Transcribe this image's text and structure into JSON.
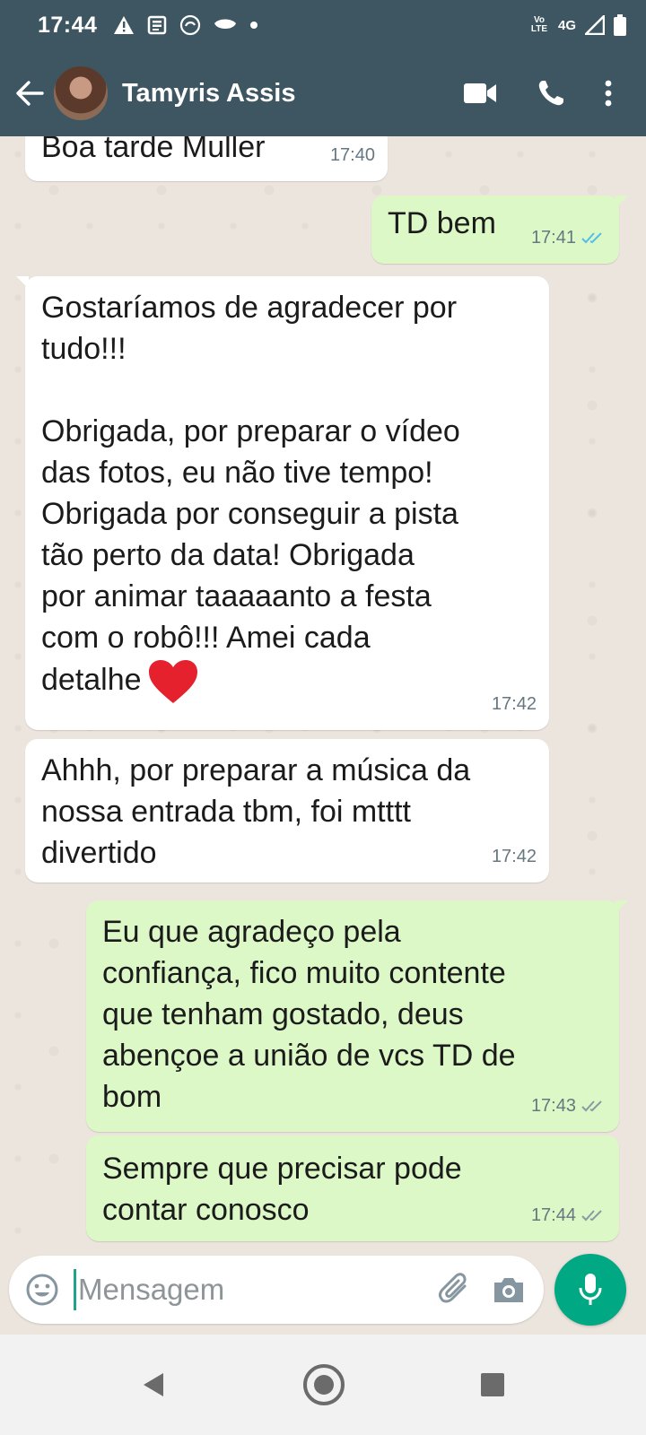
{
  "status_bar": {
    "time": "17:44",
    "network_label": "4G",
    "volte_label": "Vo LTE"
  },
  "header": {
    "contact_name": "Tamyris Assis",
    "icons": [
      "back-arrow-icon",
      "video-call-icon",
      "phone-icon",
      "more-vert-icon"
    ]
  },
  "messages": [
    {
      "direction": "in",
      "text": "Boa tarde Muller",
      "time": "17:40"
    },
    {
      "direction": "out",
      "text": "TD bem",
      "time": "17:41",
      "status": "read"
    },
    {
      "direction": "in",
      "text": "Gostaríamos de agradecer por\ntudo!!!\n\nObrigada, por preparar o vídeo\ndas fotos, eu não tive tempo!\nObrigada por conseguir a pista\ntão perto da data! Obrigada\npor animar taaaaanto a festa\ncom o robô!!! Amei cada\ndetalhe",
      "emoji": "red-heart-icon",
      "time": "17:42"
    },
    {
      "direction": "in",
      "text": "Ahhh, por preparar a música da\nnossa entrada tbm, foi mtttt\ndivertido",
      "time": "17:42"
    },
    {
      "direction": "out",
      "text": "Eu que agradeço pela\nconfiança, fico muito contente\nque tenham gostado, deus\nabençoe a união de vcs TD de\nbom",
      "time": "17:43",
      "status": "delivered"
    },
    {
      "direction": "out",
      "text": "Sempre que precisar pode\ncontar conosco",
      "time": "17:44",
      "status": "delivered"
    }
  ],
  "composer": {
    "placeholder": "Mensagem"
  },
  "colors": {
    "header": "#3d5661",
    "incoming_bubble": "#ffffff",
    "outgoing_bubble": "#dcf8c6",
    "read_ticks": "#53bdeb",
    "mic_button": "#00a884"
  }
}
